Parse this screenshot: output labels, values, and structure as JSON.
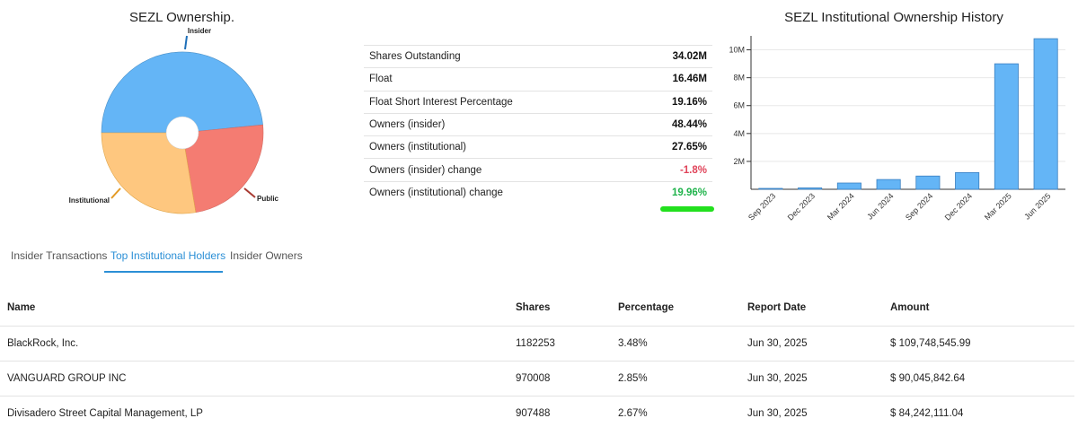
{
  "ownership_chart": {
    "title": "SEZL Ownership.",
    "chart_data": {
      "type": "pie",
      "slices": [
        {
          "label": "Insider",
          "value": 48.44,
          "color": "#64b5f6"
        },
        {
          "label": "Public",
          "value": 23.91,
          "color": "#f47c72"
        },
        {
          "label": "Institutional",
          "value": 27.65,
          "color": "#fec77f"
        }
      ]
    }
  },
  "stats": {
    "rows": [
      {
        "label": "Shares Outstanding",
        "value": "34.02M",
        "tone": "normal"
      },
      {
        "label": "Float",
        "value": "16.46M",
        "tone": "normal"
      },
      {
        "label": "Float Short Interest Percentage",
        "value": "19.16%",
        "tone": "normal"
      },
      {
        "label": "Owners (insider)",
        "value": "48.44%",
        "tone": "normal"
      },
      {
        "label": "Owners (institutional)",
        "value": "27.65%",
        "tone": "normal"
      },
      {
        "label": "Owners (insider) change",
        "value": "-1.8%",
        "tone": "neg"
      },
      {
        "label": "Owners (institutional) change",
        "value": "19.96%",
        "tone": "pos"
      }
    ]
  },
  "history_chart": {
    "title": "SEZL Institutional Ownership History",
    "chart_data": {
      "type": "bar",
      "categories": [
        "Sep 2023",
        "Dec 2023",
        "Mar 2024",
        "Jun 2024",
        "Sep 2024",
        "Dec 2024",
        "Mar 2025",
        "Jun 2025"
      ],
      "values": [
        30000,
        100000,
        450000,
        700000,
        950000,
        1200000,
        9000000,
        10800000
      ],
      "ylim": [
        0,
        11000000
      ],
      "yticks": [
        "2M",
        "4M",
        "6M",
        "8M",
        "10M"
      ],
      "ytick_values": [
        2000000,
        4000000,
        6000000,
        8000000,
        10000000
      ],
      "bar_color": "#64b5f6"
    }
  },
  "tabs": [
    {
      "label": "Insider Transactions",
      "active": false
    },
    {
      "label": "Top Institutional Holders",
      "active": true
    },
    {
      "label": "Insider Owners",
      "active": false
    }
  ],
  "holders": {
    "headers": {
      "name": "Name",
      "shares": "Shares",
      "percentage": "Percentage",
      "report_date": "Report Date",
      "amount": "Amount"
    },
    "rows": [
      {
        "name": "BlackRock, Inc.",
        "shares": "1182253",
        "percentage": "3.48%",
        "report_date": "Jun 30, 2025",
        "amount": "$ 109,748,545.99"
      },
      {
        "name": "VANGUARD GROUP INC",
        "shares": "970008",
        "percentage": "2.85%",
        "report_date": "Jun 30, 2025",
        "amount": "$ 90,045,842.64"
      },
      {
        "name": "Divisadero Street Capital Management, LP",
        "shares": "907488",
        "percentage": "2.67%",
        "report_date": "Jun 30, 2025",
        "amount": "$ 84,242,111.04"
      }
    ]
  }
}
